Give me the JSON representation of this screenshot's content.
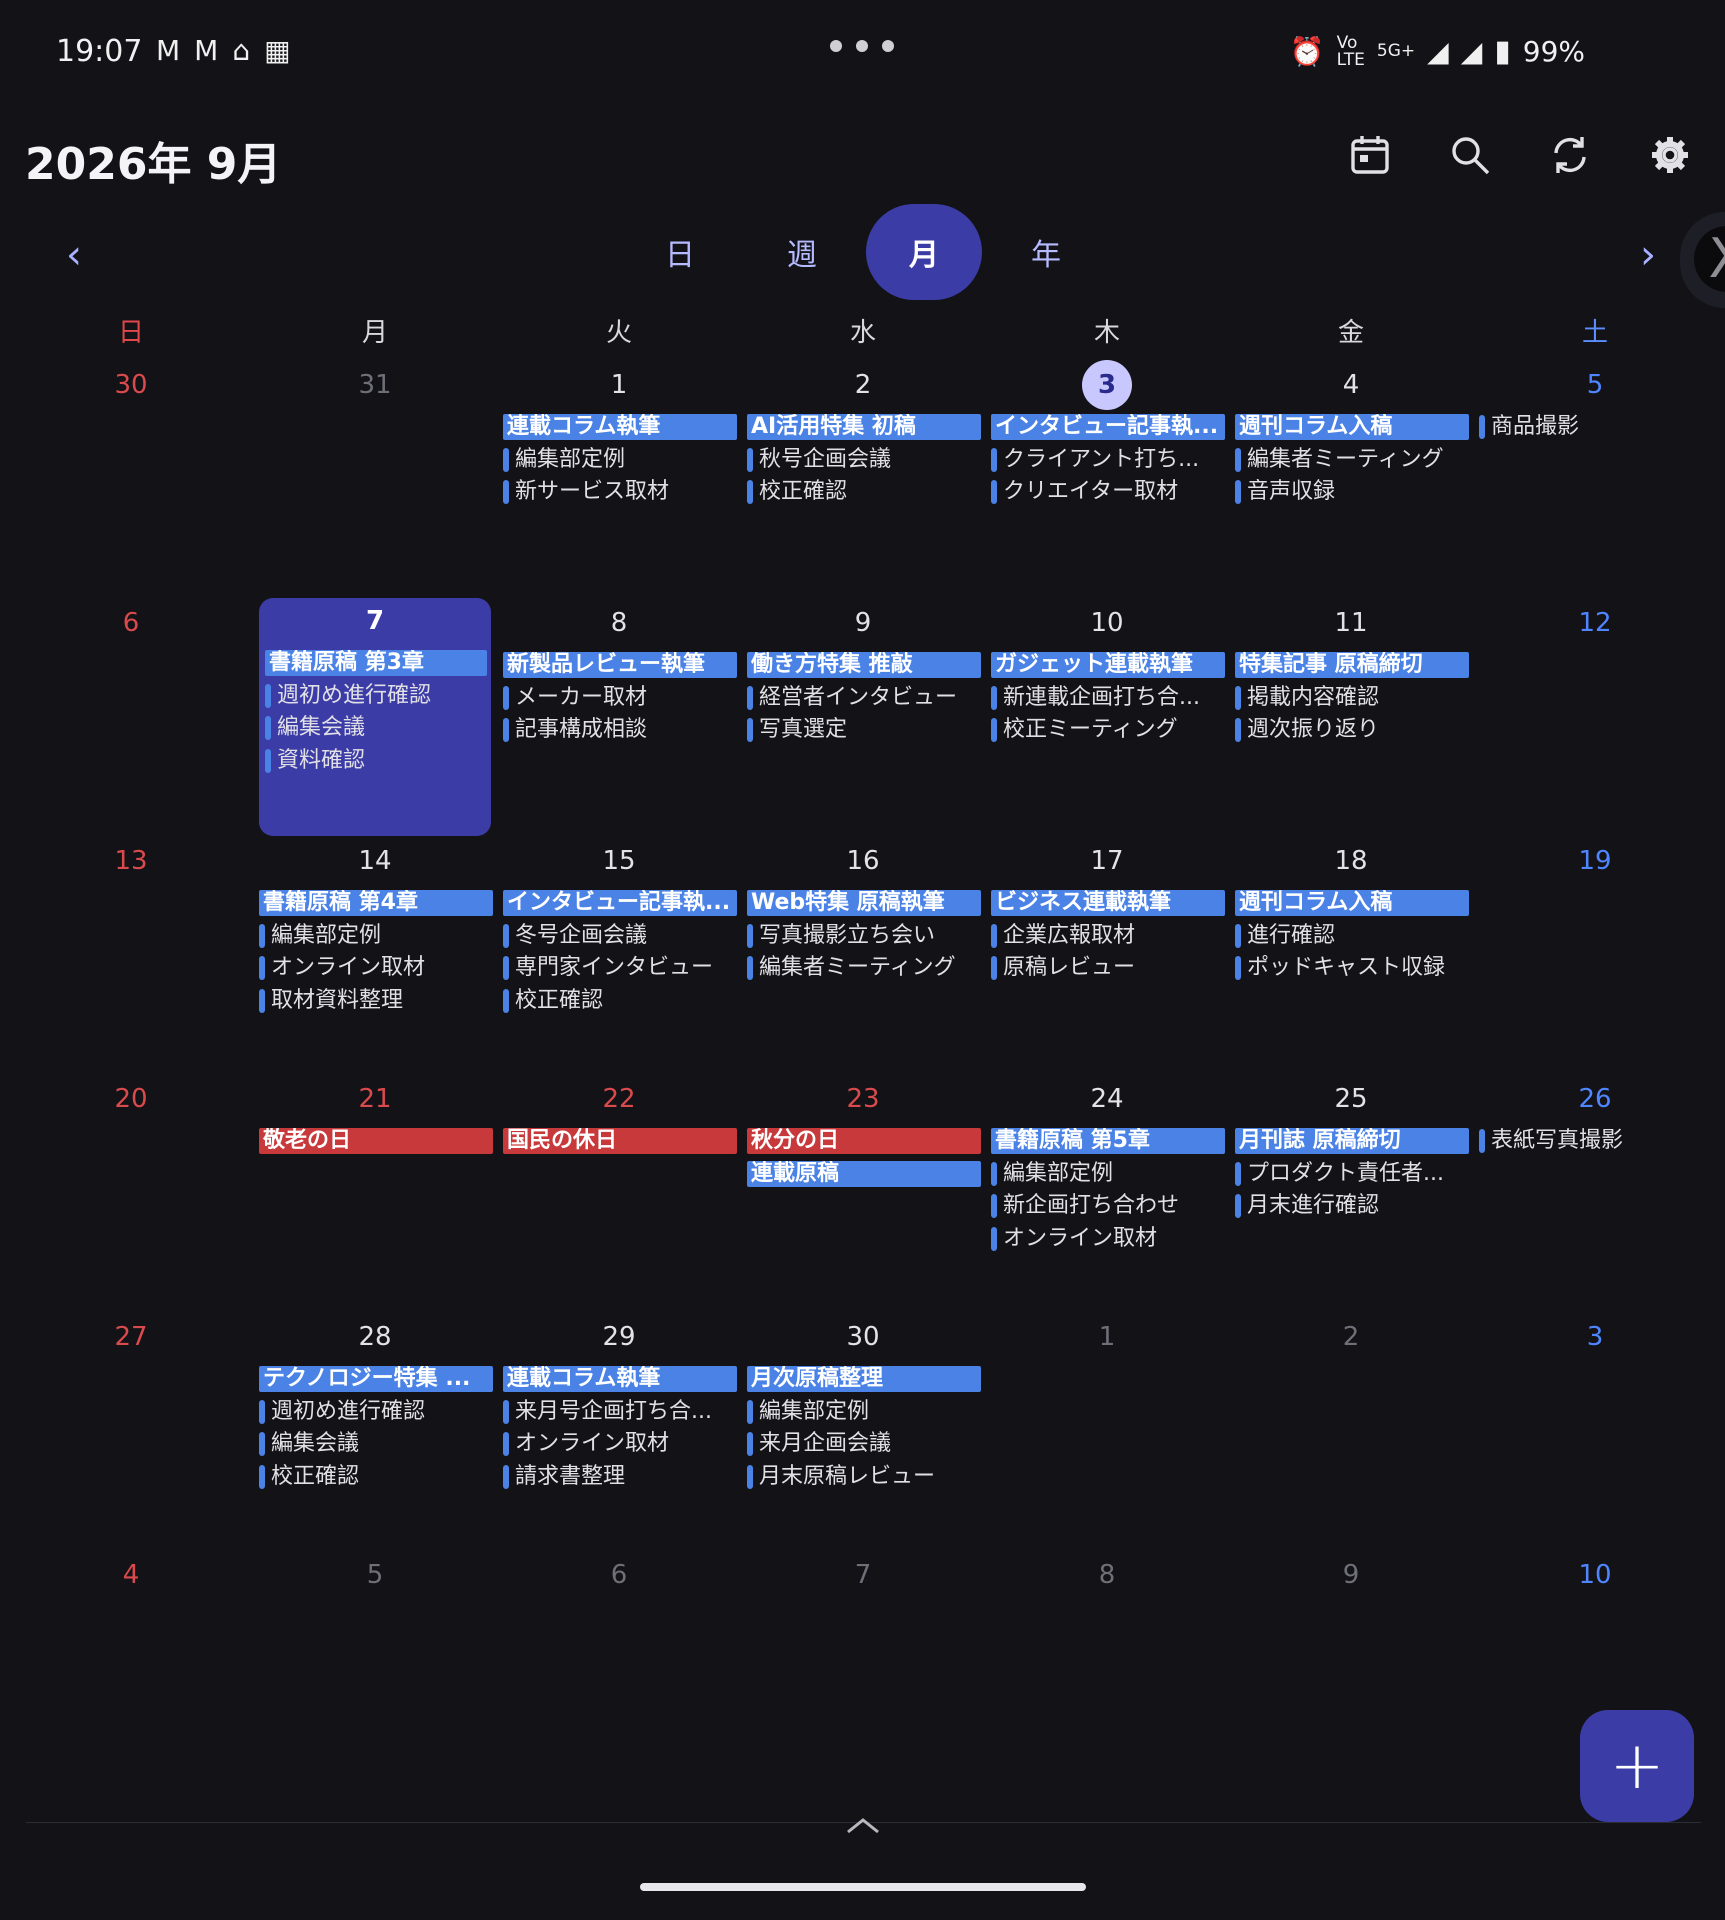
{
  "status": {
    "time": "19:07",
    "left_icons": [
      "M",
      "M",
      "⌂",
      "▦"
    ],
    "net_top": "Vo",
    "net_bottom": "LTE",
    "net_5g": "5G+",
    "battery": "99%"
  },
  "header": {
    "title": "2026年 9月"
  },
  "toolbar": {
    "today_icon": "calendar-icon",
    "search_icon": "search-icon",
    "sync_icon": "sync-icon",
    "settings_icon": "gear-icon"
  },
  "views": {
    "prev": "‹",
    "next": "›",
    "tabs": [
      "日",
      "週",
      "月",
      "年"
    ],
    "active": "月"
  },
  "x_chip": "X",
  "weekdays": [
    "日",
    "月",
    "火",
    "水",
    "木",
    "金",
    "土"
  ],
  "weeks": [
    [
      {
        "day": "30",
        "other": true,
        "events": []
      },
      {
        "day": "31",
        "other": true,
        "events": []
      },
      {
        "day": "1",
        "events": [
          {
            "t": "連載コラム執筆",
            "bar": true
          },
          {
            "t": "編集部定例"
          },
          {
            "t": "新サービス取材"
          }
        ]
      },
      {
        "day": "2",
        "events": [
          {
            "t": "AI活用特集 初稿",
            "bar": true
          },
          {
            "t": "秋号企画会議"
          },
          {
            "t": "校正確認"
          }
        ]
      },
      {
        "day": "3",
        "today": true,
        "events": [
          {
            "t": "インタビュー記事執...",
            "bar": true
          },
          {
            "t": "クライアント打ち..."
          },
          {
            "t": "クリエイター取材"
          }
        ]
      },
      {
        "day": "4",
        "events": [
          {
            "t": "週刊コラム入稿",
            "bar": true
          },
          {
            "t": "編集者ミーティング"
          },
          {
            "t": "音声収録"
          }
        ]
      },
      {
        "day": "5",
        "events": [
          {
            "t": "商品撮影"
          }
        ]
      }
    ],
    [
      {
        "day": "6",
        "events": []
      },
      {
        "day": "7",
        "selected": true,
        "events": [
          {
            "t": "書籍原稿 第3章",
            "bar": true
          },
          {
            "t": "週初め進行確認"
          },
          {
            "t": "編集会議"
          },
          {
            "t": "資料確認"
          }
        ]
      },
      {
        "day": "8",
        "events": [
          {
            "t": "新製品レビュー執筆",
            "bar": true
          },
          {
            "t": "メーカー取材"
          },
          {
            "t": "記事構成相談"
          }
        ]
      },
      {
        "day": "9",
        "events": [
          {
            "t": "働き方特集 推敲",
            "bar": true
          },
          {
            "t": "経営者インタビュー"
          },
          {
            "t": "写真選定"
          }
        ]
      },
      {
        "day": "10",
        "events": [
          {
            "t": "ガジェット連載執筆",
            "bar": true
          },
          {
            "t": "新連載企画打ち合..."
          },
          {
            "t": "校正ミーティング"
          }
        ]
      },
      {
        "day": "11",
        "events": [
          {
            "t": "特集記事 原稿締切",
            "bar": true
          },
          {
            "t": "掲載内容確認"
          },
          {
            "t": "週次振り返り"
          }
        ]
      },
      {
        "day": "12",
        "events": []
      }
    ],
    [
      {
        "day": "13",
        "events": []
      },
      {
        "day": "14",
        "events": [
          {
            "t": "書籍原稿 第4章",
            "bar": true
          },
          {
            "t": "編集部定例"
          },
          {
            "t": "オンライン取材"
          },
          {
            "t": "取材資料整理"
          }
        ]
      },
      {
        "day": "15",
        "events": [
          {
            "t": "インタビュー記事執...",
            "bar": true
          },
          {
            "t": "冬号企画会議"
          },
          {
            "t": "専門家インタビュー"
          },
          {
            "t": "校正確認"
          }
        ]
      },
      {
        "day": "16",
        "events": [
          {
            "t": "Web特集 原稿執筆",
            "bar": true
          },
          {
            "t": "写真撮影立ち会い"
          },
          {
            "t": "編集者ミーティング"
          }
        ]
      },
      {
        "day": "17",
        "events": [
          {
            "t": "ビジネス連載執筆",
            "bar": true
          },
          {
            "t": "企業広報取材"
          },
          {
            "t": "原稿レビュー"
          }
        ]
      },
      {
        "day": "18",
        "events": [
          {
            "t": "週刊コラム入稿",
            "bar": true
          },
          {
            "t": "進行確認"
          },
          {
            "t": "ポッドキャスト収録"
          }
        ]
      },
      {
        "day": "19",
        "events": []
      }
    ],
    [
      {
        "day": "20",
        "events": []
      },
      {
        "day": "21",
        "holiday": true,
        "events": [
          {
            "t": "敬老の日",
            "bar": true,
            "holiday": true
          }
        ]
      },
      {
        "day": "22",
        "holiday": true,
        "events": [
          {
            "t": "国民の休日",
            "bar": true,
            "holiday": true
          }
        ]
      },
      {
        "day": "23",
        "holiday": true,
        "events": [
          {
            "t": "秋分の日",
            "bar": true,
            "holiday": true
          },
          {
            "t": "連載原稿",
            "bar": true
          }
        ]
      },
      {
        "day": "24",
        "events": [
          {
            "t": "書籍原稿 第5章",
            "bar": true
          },
          {
            "t": "編集部定例"
          },
          {
            "t": "新企画打ち合わせ"
          },
          {
            "t": "オンライン取材"
          }
        ]
      },
      {
        "day": "25",
        "events": [
          {
            "t": "月刊誌 原稿締切",
            "bar": true
          },
          {
            "t": "プロダクト責任者..."
          },
          {
            "t": "月末進行確認"
          }
        ]
      },
      {
        "day": "26",
        "events": [
          {
            "t": "表紙写真撮影"
          }
        ]
      }
    ],
    [
      {
        "day": "27",
        "events": []
      },
      {
        "day": "28",
        "events": [
          {
            "t": "テクノロジー特集 ...",
            "bar": true
          },
          {
            "t": "週初め進行確認"
          },
          {
            "t": "編集会議"
          },
          {
            "t": "校正確認"
          }
        ]
      },
      {
        "day": "29",
        "events": [
          {
            "t": "連載コラム執筆",
            "bar": true
          },
          {
            "t": "来月号企画打ち合..."
          },
          {
            "t": "オンライン取材"
          },
          {
            "t": "請求書整理"
          }
        ]
      },
      {
        "day": "30",
        "events": [
          {
            "t": "月次原稿整理",
            "bar": true
          },
          {
            "t": "編集部定例"
          },
          {
            "t": "来月企画会議"
          },
          {
            "t": "月末原稿レビュー"
          }
        ]
      },
      {
        "day": "1",
        "other": true,
        "events": []
      },
      {
        "day": "2",
        "other": true,
        "events": []
      },
      {
        "day": "3",
        "other": true,
        "events": []
      }
    ],
    [
      {
        "day": "4",
        "other": true,
        "events": []
      },
      {
        "day": "5",
        "other": true,
        "events": []
      },
      {
        "day": "6",
        "other": true,
        "events": []
      },
      {
        "day": "7",
        "other": true,
        "events": []
      },
      {
        "day": "8",
        "other": true,
        "events": []
      },
      {
        "day": "9",
        "other": true,
        "events": []
      },
      {
        "day": "10",
        "other": true,
        "events": []
      }
    ]
  ],
  "fab": {
    "label": "+"
  },
  "colors": {
    "accent": "#3c3ca6",
    "event_bar": "#4a82e6",
    "holiday_bar": "#c8393b",
    "sunday": "#d94a4c",
    "saturday": "#4f86ff"
  }
}
